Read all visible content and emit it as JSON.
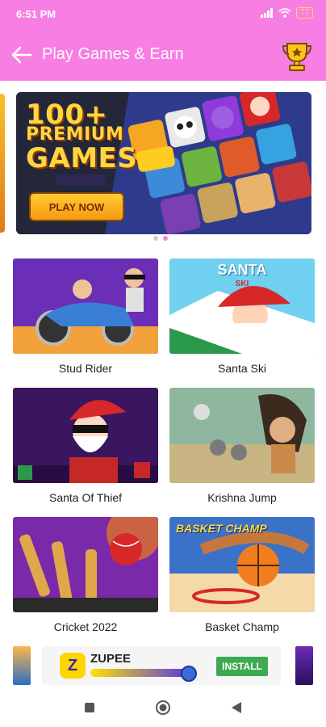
{
  "status_bar": {
    "time": "6:51 PM",
    "battery": "77"
  },
  "app_bar": {
    "title": "Play Games & Earn"
  },
  "banner": {
    "line1": "100+",
    "line2": "PREMIUM",
    "line3": "GAMES",
    "cta": "PLAY NOW",
    "page_count": 2,
    "active_page": 2
  },
  "games": [
    {
      "name": "Stud Rider"
    },
    {
      "name": "Santa Ski",
      "thumb_text": "SANTA",
      "thumb_subtext": "SKI"
    },
    {
      "name": "Santa Of Thief"
    },
    {
      "name": "Krishna Jump"
    },
    {
      "name": "Cricket 2022"
    },
    {
      "name": "Basket Champ",
      "thumb_text": "BASKET CHAMP"
    }
  ],
  "ad": {
    "brand": "ZUPEE",
    "cta": "INSTALL"
  },
  "colors": {
    "accent": "#f77ee3",
    "install": "#3daa53"
  },
  "icons": [
    "back-arrow-icon",
    "trophy-icon",
    "wifi-icon",
    "signal-icon",
    "battery-icon",
    "nav-recents-icon",
    "nav-home-icon",
    "nav-back-icon"
  ]
}
